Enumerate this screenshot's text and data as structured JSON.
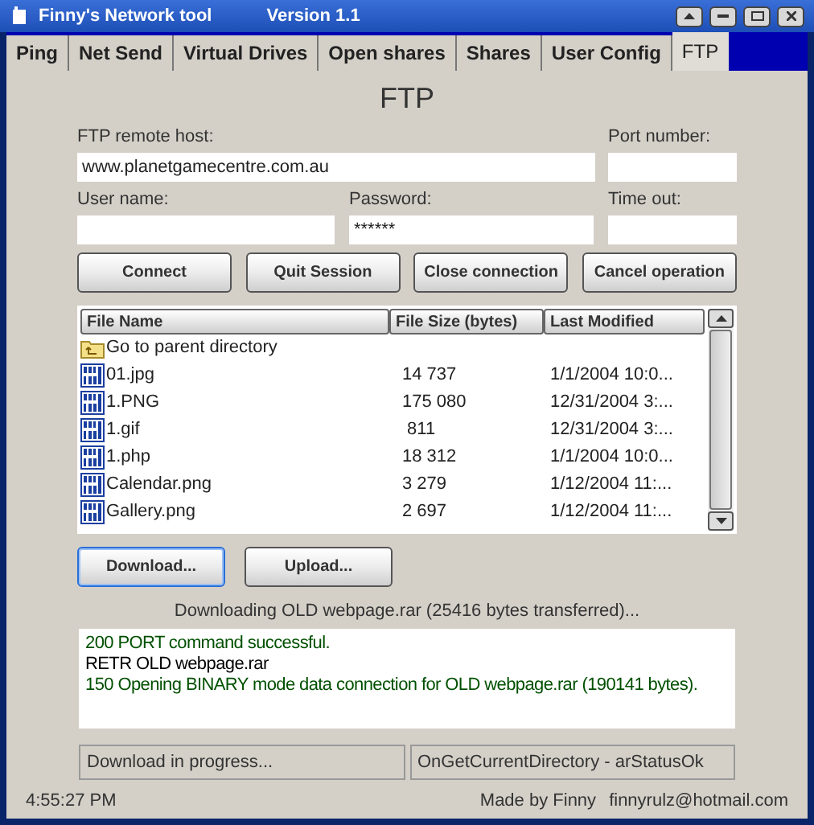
{
  "window": {
    "title": "Finny's Network tool",
    "version": "Version 1.1"
  },
  "tabs": [
    {
      "label": "Ping",
      "selected": false
    },
    {
      "label": "Net Send",
      "selected": false
    },
    {
      "label": "Virtual Drives",
      "selected": false
    },
    {
      "label": "Open shares",
      "selected": false
    },
    {
      "label": "Shares",
      "selected": false
    },
    {
      "label": "User Config",
      "selected": false
    },
    {
      "label": "FTP",
      "selected": true
    }
  ],
  "heading": "FTP",
  "fields": {
    "host": {
      "label": "FTP remote host:",
      "value": "www.planetgamecentre.com.au"
    },
    "port": {
      "label": "Port number:"
    },
    "user": {
      "label": "User name:"
    },
    "password": {
      "label": "Password:",
      "value": "******"
    },
    "timeout": {
      "label": "Time out:"
    }
  },
  "buttons": [
    {
      "label": "Connect",
      "selected": false
    },
    {
      "label": "Quit Session",
      "selected": false
    },
    {
      "label": "Close connection",
      "selected": false
    },
    {
      "label": "Cancel operation",
      "selected": false
    }
  ],
  "file_list": {
    "columns": [
      "File Name",
      "File Size (bytes)",
      "Last Modified"
    ],
    "rows": [
      {
        "kind": "folder",
        "name": "Go to parent directory"
      },
      {
        "kind": "file",
        "name": "01.jpg",
        "size": "14 737",
        "modified": "1/1/2004 10:0..."
      },
      {
        "kind": "file",
        "name": "1.PNG",
        "size": "175 080",
        "modified": "12/31/2004 3:..."
      },
      {
        "kind": "file",
        "name": "1.gif",
        "size": " 811",
        "modified": "12/31/2004 3:..."
      },
      {
        "kind": "file",
        "name": "1.php",
        "size": "18 312",
        "modified": "1/1/2004 10:0..."
      },
      {
        "kind": "file",
        "name": "Calendar.png",
        "size": "3 279",
        "modified": "1/12/2004 11:..."
      },
      {
        "kind": "file",
        "name": "Gallery.png",
        "size": "2 697",
        "modified": "1/12/2004 11:..."
      }
    ]
  },
  "transfer_buttons": [
    {
      "label": "Download...",
      "selected": true
    },
    {
      "label": "Upload...",
      "selected": false
    }
  ],
  "transfer_status": "Downloading OLD webpage.rar (25416 bytes transferred)...",
  "log": [
    {
      "text": "200 PORT command successful.",
      "color": "#005000"
    },
    {
      "text": "RETR OLD webpage.rar",
      "color": "#000000"
    },
    {
      "text": "150 Opening BINARY mode data connection for OLD webpage.rar (190141 bytes).",
      "color": "#005000"
    }
  ],
  "status_bar": [
    "Download in progress...",
    "OnGetCurrentDirectory - arStatusOk"
  ],
  "footer": {
    "time": "4:55:27 PM",
    "credit": "Made by Finny",
    "email": "finnyrulz@hotmail.com"
  }
}
